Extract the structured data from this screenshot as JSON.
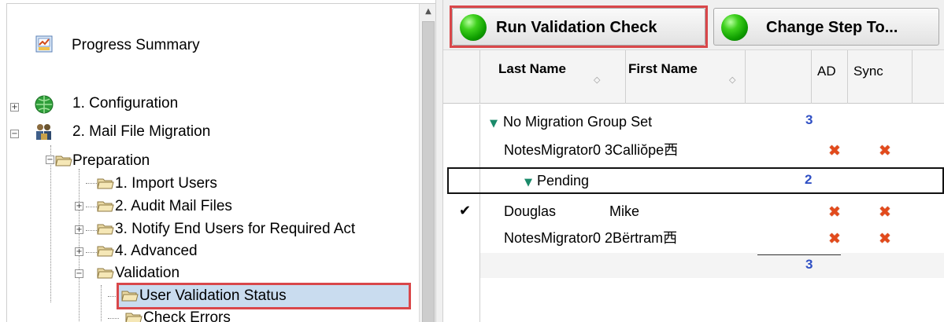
{
  "tree": {
    "progress_summary": "Progress Summary",
    "configuration": "1. Configuration",
    "mail_file_migration": "2. Mail File Migration",
    "preparation": "Preparation",
    "import_users": "1. Import Users",
    "audit_mail_files": "2. Audit Mail Files",
    "notify_end_users": "3. Notify End Users for Required Act",
    "advanced": "4. Advanced",
    "validation": "Validation",
    "user_validation_status": "User Validation Status",
    "check_errors": "Check Errors",
    "expand_plus": "+",
    "expand_minus": "−",
    "scroll_up_glyph": "▲"
  },
  "toolbar": {
    "run_validation_check": "Run Validation Check",
    "change_step_to": "Change Step To..."
  },
  "grid": {
    "columns": {
      "last_name": "Last Name",
      "first_name": "First Name",
      "ad": "AD",
      "sync": "Sync",
      "sort_glyph": "◇"
    },
    "group_no_migration": "No Migration Group Set",
    "group_no_migration_count": "3",
    "group_pending": "Pending",
    "group_pending_count": "2",
    "rows": [
      {
        "name": "NotesMigrator0 3Calliŏpe西",
        "ad": "✖",
        "sync": "✖"
      },
      {
        "last": "Douglas",
        "first": "Mike",
        "ad": "✖",
        "sync": "✖",
        "check": "✔"
      },
      {
        "name": "NotesMigrator0 2Bërtram西",
        "ad": "✖",
        "sync": "✖"
      }
    ],
    "total": "3",
    "expanded_glyph": "▼"
  },
  "colors": {
    "highlight": "#d9474a",
    "count_blue": "#2f4fc4",
    "error_red": "#e24a1c",
    "selected_bg": "#c9dcef"
  }
}
